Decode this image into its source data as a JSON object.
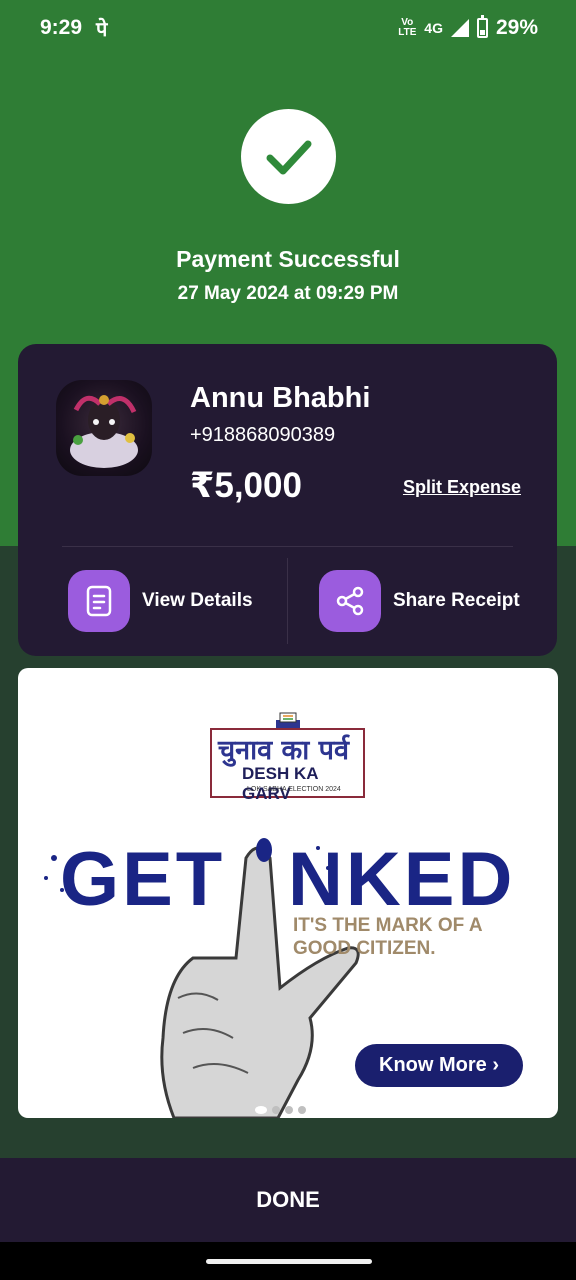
{
  "status_bar": {
    "time": "9:29",
    "carrier_glyph": "पे",
    "volte_label": "Vo LTE",
    "network": "4G",
    "battery": "29%",
    "battery_level": 0.29
  },
  "header": {
    "title": "Payment Successful",
    "datetime": "27 May 2024 at 09:29 PM"
  },
  "payee": {
    "name": "Annu Bhabhi",
    "phone": "+918868090389",
    "amount": "₹5,000",
    "split_label": "Split Expense"
  },
  "actions": [
    {
      "label": "View Details",
      "icon": "document-icon"
    },
    {
      "label": "Share Receipt",
      "icon": "share-icon"
    }
  ],
  "ad": {
    "logo_hindi": "चुनाव का पर्व",
    "logo_english": "DESH KA GARV",
    "logo_sub": "LOK SABHA ELECTION 2024",
    "headline_left": "GET",
    "headline_right": "NKED",
    "tagline": "IT'S THE MARK OF A GOOD CITIZEN.",
    "button_label": "Know More ›",
    "carousel_pages": 4,
    "carousel_active": 1
  },
  "footer": {
    "done_label": "DONE"
  },
  "colors": {
    "success_green": "#2f7d35",
    "card_dark": "#231a33",
    "action_purple": "#9b5cde",
    "ad_navy": "#1a2585"
  }
}
